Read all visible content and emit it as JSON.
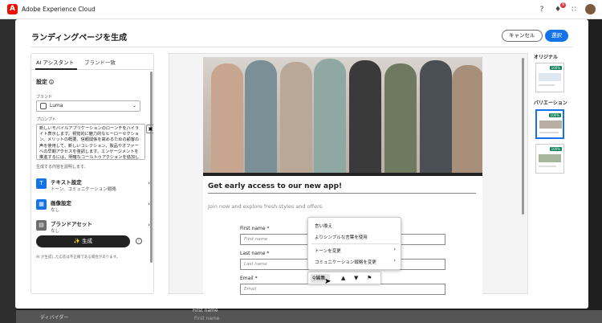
{
  "topbar": {
    "app_title": "Adobe Experience Cloud",
    "logo_glyph": "A",
    "notif_count": "9"
  },
  "dialog": {
    "title": "ランディングページを生成",
    "cancel_label": "キャンセル",
    "select_label": "選択"
  },
  "left_panel": {
    "tabs": [
      "AI アシスタント",
      "ブランド一致"
    ],
    "section_title": "設定",
    "brand_label": "ブランド",
    "brand_value": "Luma",
    "prompt_label": "プロンプト",
    "prompt_text": "新しいモバイルアプリケーションのローンチをハイライト表示します。視覚的に魅力的なヒーローセクション、メリットの概要、信頼関係を高めるための顧客の声を使用して、新しいコレクション、製品やオファーへの早期アクセスを強調します。エンゲージメントを推進するには、明確なコールトゥアクションを追加します。",
    "hint": "生成する内容を説明します。",
    "settings": [
      {
        "title": "テキスト設定",
        "sub": "トーン、コミュニケーション戦略",
        "icon": "text-icon"
      },
      {
        "title": "画像設定",
        "sub": "なし",
        "icon": "image-icon"
      },
      {
        "title": "ブランドアセット",
        "sub": "なし",
        "icon": "asset-icon"
      }
    ],
    "generate_label": "生成",
    "disclaimer": "AI が生成した応答は不正確である場合があります。"
  },
  "preview": {
    "headline": "Get early access to our new app!",
    "subline": "Join now and explore fresh styles and offers.",
    "fields": [
      {
        "label": "First name",
        "placeholder": "First name"
      },
      {
        "label": "Last name",
        "placeholder": "Last name"
      },
      {
        "label": "Email",
        "placeholder": "Email"
      }
    ],
    "context_menu": [
      "言い換え",
      "よりシンプルな言葉を使用",
      "トーンを変更",
      "コミュニケーション戦略を変更"
    ],
    "mini_toolbar_edit": "編集"
  },
  "right_col": {
    "original_label": "オリジナル",
    "variation_label": "バリエーション",
    "badge": "100%"
  },
  "background": {
    "divider_label": "ディバイダー",
    "field_label": "First name",
    "field_placeholder": "First name"
  },
  "colors": {
    "accent": "#1473e6",
    "badge": "#12805c",
    "adobe_red": "#eb1000"
  }
}
